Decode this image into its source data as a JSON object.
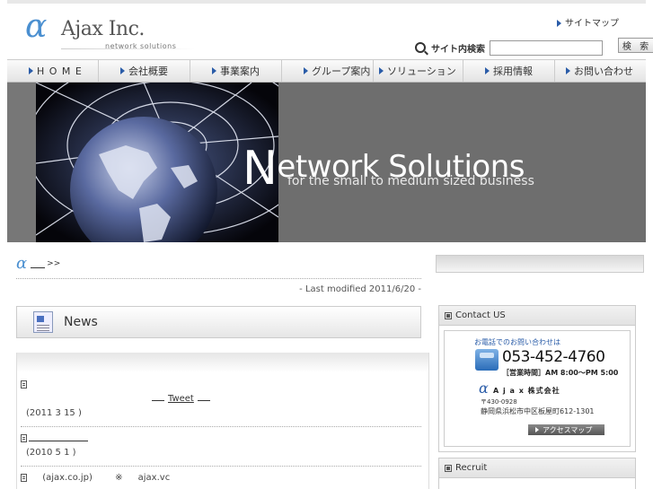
{
  "header": {
    "logo_name": "Ajax Inc.",
    "logo_sub": "network solutions",
    "sitemap_label": "サイトマップ",
    "search_label": "サイト内検索",
    "search_value": "",
    "search_button": "検 索"
  },
  "nav": {
    "items": [
      {
        "label": "H O M E"
      },
      {
        "label": "会社概要"
      },
      {
        "label": "事業案内"
      },
      {
        "label": "グループ案内"
      },
      {
        "label": "ソリューション"
      },
      {
        "label": "採用情報"
      },
      {
        "label": "お問い合わせ"
      }
    ]
  },
  "hero": {
    "title_rest": "etwork Solutions",
    "subtitle": "for the small to medium sized business"
  },
  "main": {
    "crumb_arrow": ">>",
    "modified": "- Last modified 2011/6/20 -",
    "news_title": "News",
    "rows": [
      {
        "tweet_label": "Tweet",
        "date": "(2011 3 15 )"
      },
      {
        "date": "(2010 5 1 )"
      },
      {
        "domain_jp": "(ajax.co.jp)",
        "sep": "※",
        "domain_vc": "ajax.vc"
      }
    ]
  },
  "side": {
    "contact_title": "Contact US",
    "contact_lead": "お電話でのお問い合わせは",
    "phone": "053-452-4760",
    "hours": "［営業時間］AM 8:00〜PM 5:00",
    "company": "A j a x 株式会社",
    "zip": "〒430-0928",
    "address": "静岡県浜松市中区板屋町612-1301",
    "access_label": "アクセスマップ",
    "recruit_title": "Recruit"
  },
  "colors": {
    "accent": "#2a5ca8",
    "logo_alpha": "#4a8fd0",
    "hero_gray": "#6e6e6e"
  }
}
